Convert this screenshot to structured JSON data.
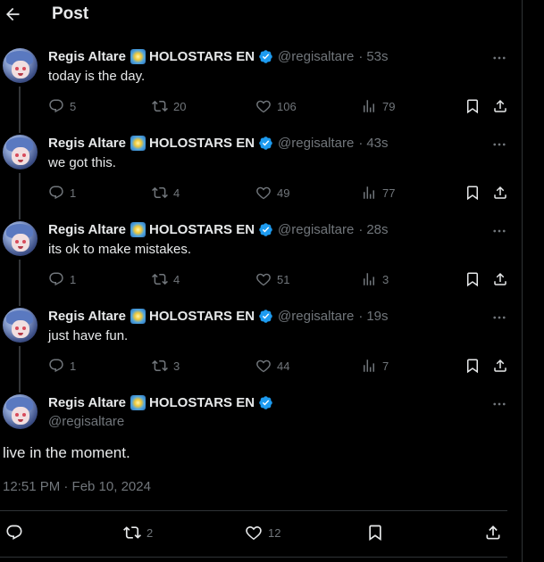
{
  "header": {
    "title": "Post",
    "back_icon": "arrow-left-icon"
  },
  "author": {
    "name": "Regis Altare",
    "org": "HOLOSTARS EN",
    "handle": "@regisaltare"
  },
  "thread": [
    {
      "time": "53s",
      "text": "today is the day.",
      "replies": "5",
      "reposts": "20",
      "likes": "106",
      "views": "79"
    },
    {
      "time": "43s",
      "text": "we got this.",
      "replies": "1",
      "reposts": "4",
      "likes": "49",
      "views": "77"
    },
    {
      "time": "28s",
      "text": "its ok to make mistakes.",
      "replies": "1",
      "reposts": "4",
      "likes": "51",
      "views": "3"
    },
    {
      "time": "19s",
      "text": "just have fun.",
      "replies": "1",
      "reposts": "3",
      "likes": "44",
      "views": "7"
    }
  ],
  "main_post": {
    "text": "live in the moment.",
    "timestamp": "12:51 PM · Feb 10, 2024",
    "reposts": "2",
    "likes": "12"
  },
  "colors": {
    "background": "#000000",
    "text": "#e7e9ea",
    "muted": "#71767b",
    "verified": "#1d9bf0"
  }
}
